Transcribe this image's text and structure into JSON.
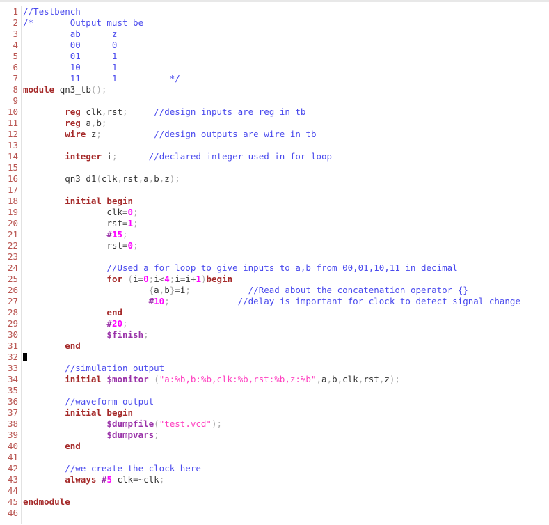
{
  "editor": {
    "language": "verilog",
    "file_kind": "testbench",
    "gutter_color": "#b85450",
    "background_color": "#ffffff",
    "colors": {
      "keyword": "#a52a2a",
      "comment": "#4a4aed",
      "number": "#ff00ff",
      "string": "#ff40c0",
      "system_task": "#9932a8",
      "delimiter": "#aaaaaa",
      "identifier": "#333333",
      "cursor": "#000000"
    },
    "cursor": {
      "line": 32,
      "column": 1
    },
    "total_lines": 46
  },
  "lines": [
    {
      "n": "1",
      "tokens": [
        {
          "t": "//Testbench",
          "c": "tok-com"
        }
      ]
    },
    {
      "n": "2",
      "tokens": [
        {
          "t": "/*       Output must be",
          "c": "tok-com"
        }
      ]
    },
    {
      "n": "3",
      "tokens": [
        {
          "t": "         ab      z",
          "c": "tok-com"
        }
      ]
    },
    {
      "n": "4",
      "tokens": [
        {
          "t": "         00      0",
          "c": "tok-com"
        }
      ]
    },
    {
      "n": "5",
      "tokens": [
        {
          "t": "         01      1",
          "c": "tok-com"
        }
      ]
    },
    {
      "n": "6",
      "tokens": [
        {
          "t": "         10      1",
          "c": "tok-com"
        }
      ]
    },
    {
      "n": "7",
      "tokens": [
        {
          "t": "         11      1          */",
          "c": "tok-com"
        }
      ]
    },
    {
      "n": "8",
      "tokens": [
        {
          "t": "module",
          "c": "tok-kw"
        },
        {
          "t": " ",
          "c": "tok-id"
        },
        {
          "t": "qn3_tb",
          "c": "tok-id"
        },
        {
          "t": "();",
          "c": "tok-del"
        }
      ]
    },
    {
      "n": "9",
      "tokens": []
    },
    {
      "n": "10",
      "tokens": [
        {
          "t": "        ",
          "c": "tok-id"
        },
        {
          "t": "reg",
          "c": "tok-kw"
        },
        {
          "t": " clk",
          "c": "tok-id"
        },
        {
          "t": ",",
          "c": "tok-del"
        },
        {
          "t": "rst",
          "c": "tok-id"
        },
        {
          "t": ";",
          "c": "tok-del"
        },
        {
          "t": "     ",
          "c": "tok-id"
        },
        {
          "t": "//design inputs are reg in tb",
          "c": "tok-com"
        }
      ]
    },
    {
      "n": "11",
      "tokens": [
        {
          "t": "        ",
          "c": "tok-id"
        },
        {
          "t": "reg",
          "c": "tok-kw"
        },
        {
          "t": " a",
          "c": "tok-id"
        },
        {
          "t": ",",
          "c": "tok-del"
        },
        {
          "t": "b",
          "c": "tok-id"
        },
        {
          "t": ";",
          "c": "tok-del"
        }
      ]
    },
    {
      "n": "12",
      "tokens": [
        {
          "t": "        ",
          "c": "tok-id"
        },
        {
          "t": "wire",
          "c": "tok-kw"
        },
        {
          "t": " z",
          "c": "tok-id"
        },
        {
          "t": ";",
          "c": "tok-del"
        },
        {
          "t": "          ",
          "c": "tok-id"
        },
        {
          "t": "//design outputs are wire in tb",
          "c": "tok-com"
        }
      ]
    },
    {
      "n": "13",
      "tokens": []
    },
    {
      "n": "14",
      "tokens": [
        {
          "t": "        ",
          "c": "tok-id"
        },
        {
          "t": "integer",
          "c": "tok-kw"
        },
        {
          "t": " i",
          "c": "tok-id"
        },
        {
          "t": ";",
          "c": "tok-del"
        },
        {
          "t": "      ",
          "c": "tok-id"
        },
        {
          "t": "//declared integer used in for loop",
          "c": "tok-com"
        }
      ]
    },
    {
      "n": "15",
      "tokens": []
    },
    {
      "n": "16",
      "tokens": [
        {
          "t": "        ",
          "c": "tok-id"
        },
        {
          "t": "qn3 d1",
          "c": "tok-id"
        },
        {
          "t": "(",
          "c": "tok-del"
        },
        {
          "t": "clk",
          "c": "tok-id"
        },
        {
          "t": ",",
          "c": "tok-del"
        },
        {
          "t": "rst",
          "c": "tok-id"
        },
        {
          "t": ",",
          "c": "tok-del"
        },
        {
          "t": "a",
          "c": "tok-id"
        },
        {
          "t": ",",
          "c": "tok-del"
        },
        {
          "t": "b",
          "c": "tok-id"
        },
        {
          "t": ",",
          "c": "tok-del"
        },
        {
          "t": "z",
          "c": "tok-id"
        },
        {
          "t": ");",
          "c": "tok-del"
        }
      ]
    },
    {
      "n": "17",
      "tokens": []
    },
    {
      "n": "18",
      "tokens": [
        {
          "t": "        ",
          "c": "tok-id"
        },
        {
          "t": "initial begin",
          "c": "tok-kw"
        }
      ]
    },
    {
      "n": "19",
      "tokens": [
        {
          "t": "                clk",
          "c": "tok-id"
        },
        {
          "t": "=",
          "c": "tok-op"
        },
        {
          "t": "0",
          "c": "tok-num"
        },
        {
          "t": ";",
          "c": "tok-del"
        }
      ]
    },
    {
      "n": "20",
      "tokens": [
        {
          "t": "                rst",
          "c": "tok-id"
        },
        {
          "t": "=",
          "c": "tok-op"
        },
        {
          "t": "1",
          "c": "tok-num"
        },
        {
          "t": ";",
          "c": "tok-del"
        }
      ]
    },
    {
      "n": "21",
      "tokens": [
        {
          "t": "                ",
          "c": "tok-id"
        },
        {
          "t": "#",
          "c": "tok-hash"
        },
        {
          "t": "15",
          "c": "tok-num"
        },
        {
          "t": ";",
          "c": "tok-del"
        }
      ]
    },
    {
      "n": "22",
      "tokens": [
        {
          "t": "                rst",
          "c": "tok-id"
        },
        {
          "t": "=",
          "c": "tok-op"
        },
        {
          "t": "0",
          "c": "tok-num"
        },
        {
          "t": ";",
          "c": "tok-del"
        }
      ]
    },
    {
      "n": "23",
      "tokens": []
    },
    {
      "n": "24",
      "tokens": [
        {
          "t": "                ",
          "c": "tok-id"
        },
        {
          "t": "//Used a for loop to give inputs to a,b from 00,01,10,11 in decimal",
          "c": "tok-com"
        }
      ]
    },
    {
      "n": "25",
      "tokens": [
        {
          "t": "                ",
          "c": "tok-id"
        },
        {
          "t": "for",
          "c": "tok-kw"
        },
        {
          "t": " ",
          "c": "tok-id"
        },
        {
          "t": "(",
          "c": "tok-del"
        },
        {
          "t": "i",
          "c": "tok-id"
        },
        {
          "t": "=",
          "c": "tok-op"
        },
        {
          "t": "0",
          "c": "tok-num"
        },
        {
          "t": ";",
          "c": "tok-del"
        },
        {
          "t": "i",
          "c": "tok-id"
        },
        {
          "t": "<",
          "c": "tok-op"
        },
        {
          "t": "4",
          "c": "tok-num"
        },
        {
          "t": ";",
          "c": "tok-del"
        },
        {
          "t": "i",
          "c": "tok-id"
        },
        {
          "t": "=",
          "c": "tok-op"
        },
        {
          "t": "i",
          "c": "tok-id"
        },
        {
          "t": "+",
          "c": "tok-op"
        },
        {
          "t": "1",
          "c": "tok-num"
        },
        {
          "t": ")",
          "c": "tok-del"
        },
        {
          "t": "begin",
          "c": "tok-kw"
        }
      ]
    },
    {
      "n": "26",
      "tokens": [
        {
          "t": "                        ",
          "c": "tok-id"
        },
        {
          "t": "{",
          "c": "tok-del"
        },
        {
          "t": "a",
          "c": "tok-id"
        },
        {
          "t": ",",
          "c": "tok-del"
        },
        {
          "t": "b",
          "c": "tok-id"
        },
        {
          "t": "}",
          "c": "tok-del"
        },
        {
          "t": "=",
          "c": "tok-op"
        },
        {
          "t": "i",
          "c": "tok-id"
        },
        {
          "t": ";",
          "c": "tok-del"
        },
        {
          "t": "           ",
          "c": "tok-id"
        },
        {
          "t": "//Read about the concatenation operator {}",
          "c": "tok-com"
        }
      ]
    },
    {
      "n": "27",
      "tokens": [
        {
          "t": "                        ",
          "c": "tok-id"
        },
        {
          "t": "#",
          "c": "tok-hash"
        },
        {
          "t": "10",
          "c": "tok-num"
        },
        {
          "t": ";",
          "c": "tok-del"
        },
        {
          "t": "             ",
          "c": "tok-id"
        },
        {
          "t": "//delay is important for clock to detect signal change",
          "c": "tok-com"
        }
      ]
    },
    {
      "n": "28",
      "tokens": [
        {
          "t": "                ",
          "c": "tok-id"
        },
        {
          "t": "end",
          "c": "tok-kw"
        }
      ]
    },
    {
      "n": "29",
      "tokens": [
        {
          "t": "                ",
          "c": "tok-id"
        },
        {
          "t": "#",
          "c": "tok-hash"
        },
        {
          "t": "20",
          "c": "tok-num"
        },
        {
          "t": ";",
          "c": "tok-del"
        }
      ]
    },
    {
      "n": "30",
      "tokens": [
        {
          "t": "                ",
          "c": "tok-id"
        },
        {
          "t": "$finish",
          "c": "tok-sys"
        },
        {
          "t": ";",
          "c": "tok-del"
        }
      ]
    },
    {
      "n": "31",
      "tokens": [
        {
          "t": "        ",
          "c": "tok-id"
        },
        {
          "t": "end",
          "c": "tok-kw"
        }
      ]
    },
    {
      "n": "32",
      "tokens": [],
      "cursor": true
    },
    {
      "n": "33",
      "tokens": [
        {
          "t": "        ",
          "c": "tok-id"
        },
        {
          "t": "//simulation output",
          "c": "tok-com"
        }
      ]
    },
    {
      "n": "34",
      "tokens": [
        {
          "t": "        ",
          "c": "tok-id"
        },
        {
          "t": "initial",
          "c": "tok-kw"
        },
        {
          "t": " ",
          "c": "tok-id"
        },
        {
          "t": "$monitor",
          "c": "tok-sys"
        },
        {
          "t": " ",
          "c": "tok-id"
        },
        {
          "t": "(",
          "c": "tok-del"
        },
        {
          "t": "\"a:%b,b:%b,clk:%b,rst:%b,z:%b\"",
          "c": "tok-str"
        },
        {
          "t": ",",
          "c": "tok-del"
        },
        {
          "t": "a",
          "c": "tok-id"
        },
        {
          "t": ",",
          "c": "tok-del"
        },
        {
          "t": "b",
          "c": "tok-id"
        },
        {
          "t": ",",
          "c": "tok-del"
        },
        {
          "t": "clk",
          "c": "tok-id"
        },
        {
          "t": ",",
          "c": "tok-del"
        },
        {
          "t": "rst",
          "c": "tok-id"
        },
        {
          "t": ",",
          "c": "tok-del"
        },
        {
          "t": "z",
          "c": "tok-id"
        },
        {
          "t": ");",
          "c": "tok-del"
        }
      ]
    },
    {
      "n": "35",
      "tokens": []
    },
    {
      "n": "36",
      "tokens": [
        {
          "t": "        ",
          "c": "tok-id"
        },
        {
          "t": "//waveform output",
          "c": "tok-com"
        }
      ]
    },
    {
      "n": "37",
      "tokens": [
        {
          "t": "        ",
          "c": "tok-id"
        },
        {
          "t": "initial begin",
          "c": "tok-kw"
        }
      ]
    },
    {
      "n": "38",
      "tokens": [
        {
          "t": "                ",
          "c": "tok-id"
        },
        {
          "t": "$dumpfile",
          "c": "tok-sys"
        },
        {
          "t": "(",
          "c": "tok-del"
        },
        {
          "t": "\"test.vcd\"",
          "c": "tok-str"
        },
        {
          "t": ");",
          "c": "tok-del"
        }
      ]
    },
    {
      "n": "39",
      "tokens": [
        {
          "t": "                ",
          "c": "tok-id"
        },
        {
          "t": "$dumpvars",
          "c": "tok-sys"
        },
        {
          "t": ";",
          "c": "tok-del"
        }
      ]
    },
    {
      "n": "40",
      "tokens": [
        {
          "t": "        ",
          "c": "tok-id"
        },
        {
          "t": "end",
          "c": "tok-kw"
        }
      ]
    },
    {
      "n": "41",
      "tokens": []
    },
    {
      "n": "42",
      "tokens": [
        {
          "t": "        ",
          "c": "tok-id"
        },
        {
          "t": "//we create the clock here",
          "c": "tok-com"
        }
      ]
    },
    {
      "n": "43",
      "tokens": [
        {
          "t": "        ",
          "c": "tok-id"
        },
        {
          "t": "always",
          "c": "tok-kw"
        },
        {
          "t": " ",
          "c": "tok-id"
        },
        {
          "t": "#",
          "c": "tok-hash"
        },
        {
          "t": "5",
          "c": "tok-num"
        },
        {
          "t": " clk",
          "c": "tok-id"
        },
        {
          "t": "=~",
          "c": "tok-op"
        },
        {
          "t": "clk",
          "c": "tok-id"
        },
        {
          "t": ";",
          "c": "tok-del"
        }
      ]
    },
    {
      "n": "44",
      "tokens": []
    },
    {
      "n": "45",
      "tokens": [
        {
          "t": "endmodule",
          "c": "tok-kw"
        }
      ]
    },
    {
      "n": "46",
      "tokens": []
    }
  ]
}
